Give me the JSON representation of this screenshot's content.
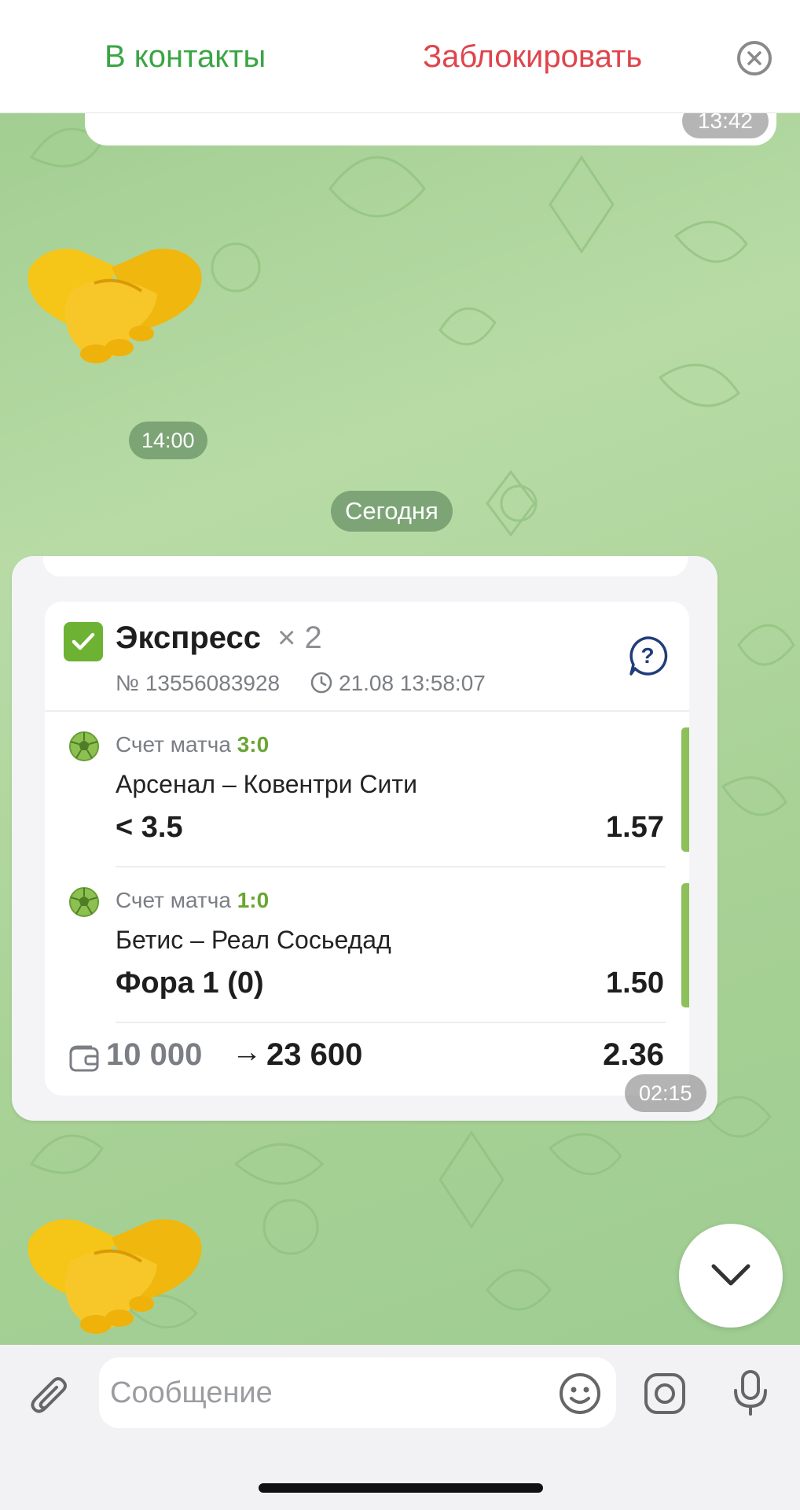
{
  "top_bar": {
    "add_contact_label": "В контакты",
    "block_label": "Заблокировать"
  },
  "previous_message": {
    "time": "13:42"
  },
  "sticker_message_1": {
    "emoji": "🤝",
    "time": "14:00"
  },
  "date_separator": "Сегодня",
  "bet_card": {
    "title": "Экспресс",
    "multiplier": "× 2",
    "bet_number": "№ 13556083928",
    "bet_datetime": "21.08 13:58:07",
    "legs": [
      {
        "market": "Счет матча",
        "score": "3:0",
        "match": "Арсенал – Ковентри Сити",
        "outcome": "< 3.5",
        "odds": "1.57"
      },
      {
        "market": "Счет матча",
        "score": "1:0",
        "match": "Бетис – Реал Сосьедад",
        "outcome": "Фора 1 (0)",
        "odds": "1.50"
      }
    ],
    "stake": "10 000",
    "arrow": "→",
    "payout": "23 600",
    "total_odds": "2.36",
    "message_time": "02:15",
    "colors": {
      "check": "#6db232",
      "score": "#6aa632",
      "status_bar": "#8dbf5b"
    }
  },
  "sticker_message_2": {
    "emoji": "🤝"
  },
  "input_bar": {
    "placeholder": "Сообщение"
  },
  "icons": {
    "close": "close-icon",
    "check": "check-icon",
    "clock": "clock-icon",
    "help": "help-icon",
    "ball": "soccer-ball-icon",
    "wallet": "wallet-icon",
    "chevron": "chevron-down-icon",
    "attach": "paperclip-icon",
    "emoji": "emoji-icon",
    "camera": "camera-icon",
    "mic": "microphone-icon"
  }
}
